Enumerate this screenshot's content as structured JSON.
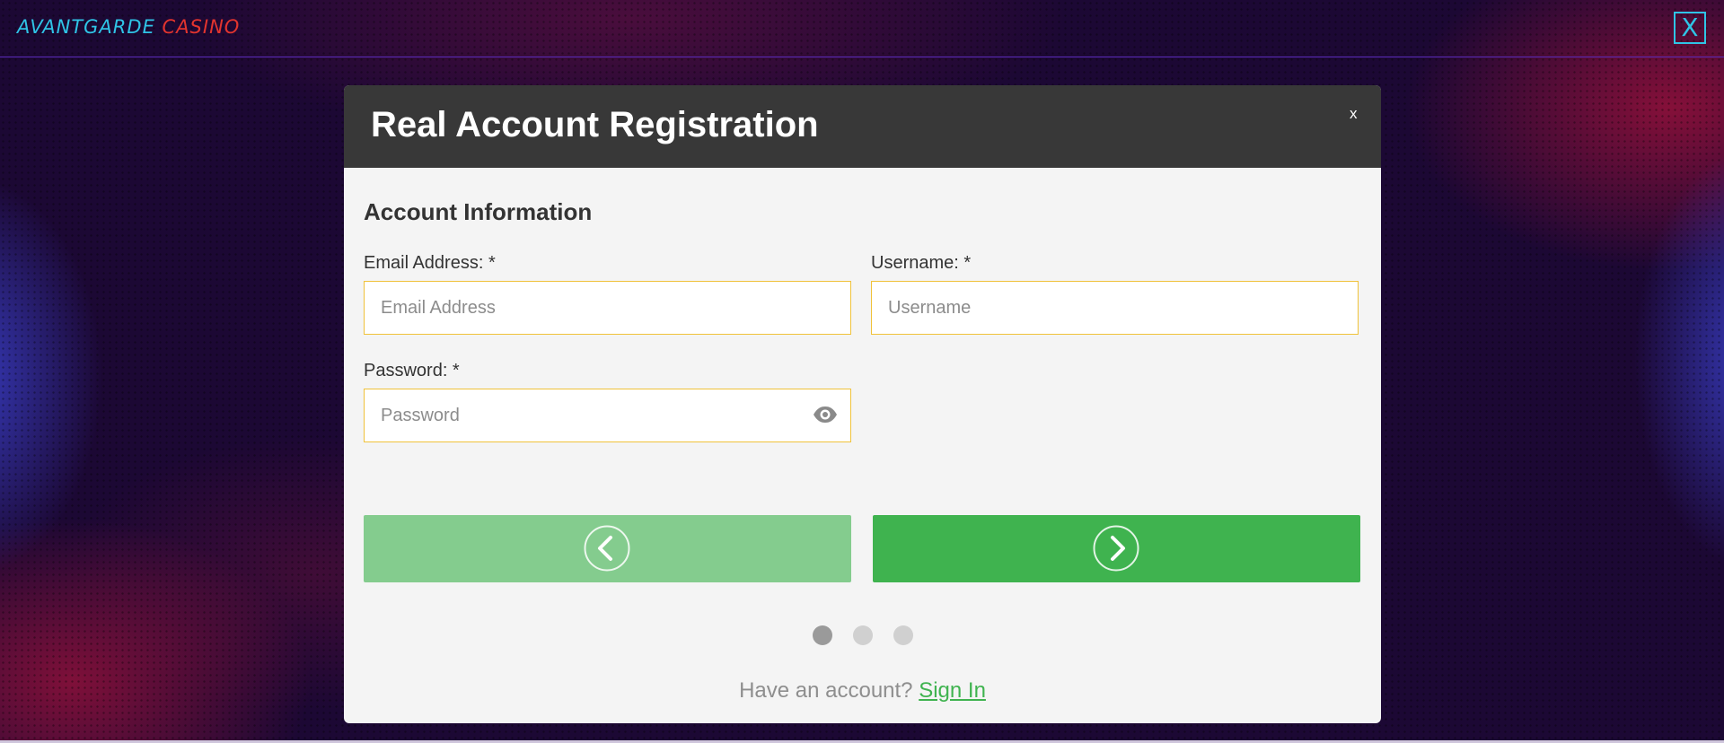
{
  "header": {
    "logo_part1": "AVANTGARDE",
    "logo_part2": "CASINO",
    "close_label": "X"
  },
  "modal": {
    "title": "Real Account Registration",
    "close_label": "x",
    "section_title": "Account Information",
    "fields": {
      "email": {
        "label": "Email Address: *",
        "placeholder": "Email Address",
        "value": ""
      },
      "username": {
        "label": "Username: *",
        "placeholder": "Username",
        "value": ""
      },
      "password": {
        "label": "Password: *",
        "placeholder": "Password",
        "value": ""
      }
    },
    "steps": {
      "current": 1,
      "total": 3
    },
    "footer": {
      "prompt": "Have an account?",
      "link": "Sign In"
    }
  },
  "colors": {
    "accent_cyan": "#2fc4e6",
    "accent_red": "#e2342e",
    "next_green": "#3fb34f",
    "prev_green_disabled": "#84cc8e",
    "input_border": "#f0c23a",
    "header_bg": "#383838"
  },
  "icons": {
    "prev": "chevron-left-circle-icon",
    "next": "chevron-right-circle-icon",
    "password_toggle": "eye-icon"
  }
}
